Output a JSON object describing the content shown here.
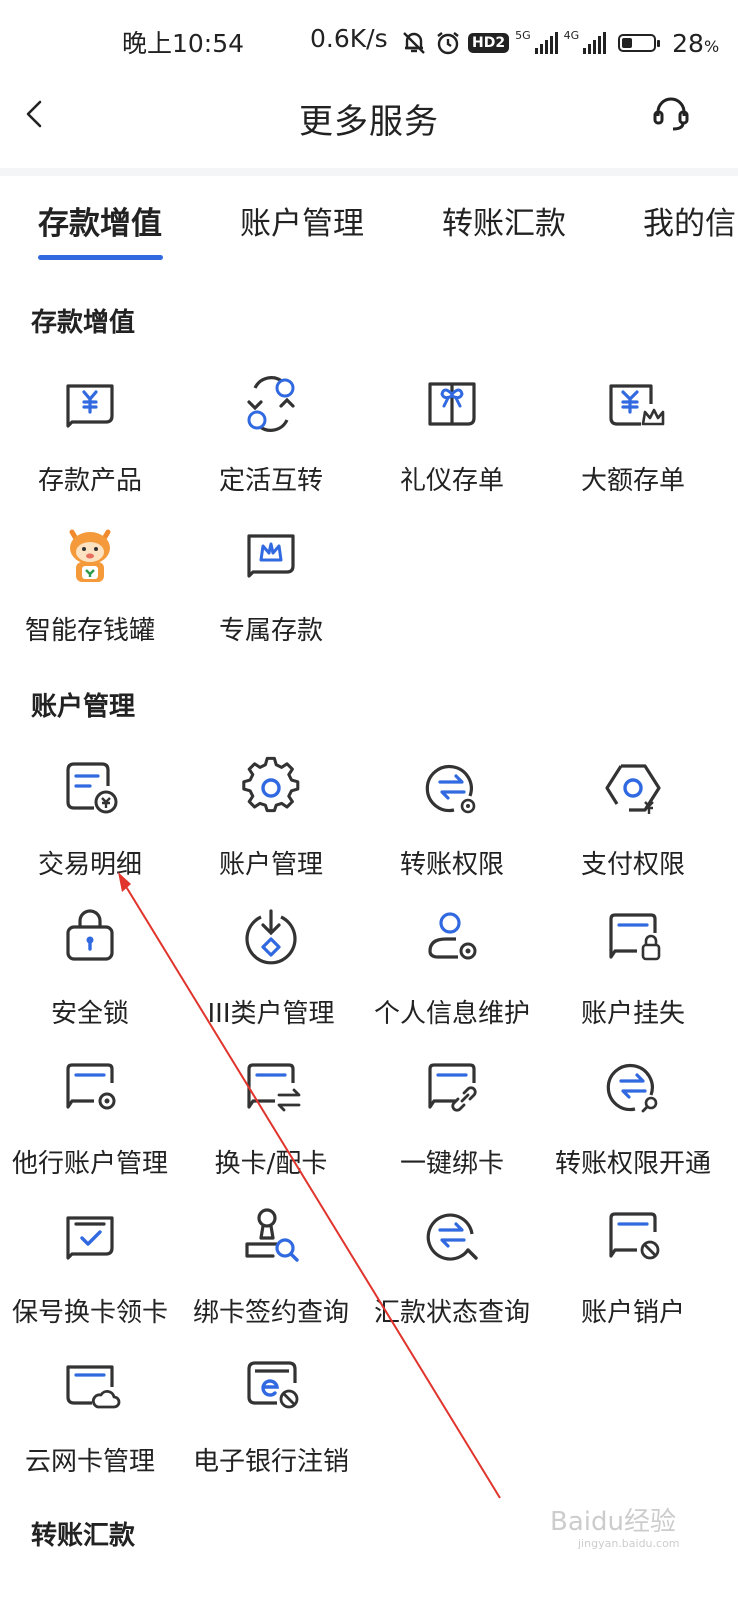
{
  "status_bar": {
    "time": "晚上10:54",
    "speed": "0.6K/s",
    "hd_badge": "HD2",
    "net_5g": "5G",
    "net_4g": "4G",
    "battery": "28",
    "battery_unit": "%",
    "battery_level": 0.28
  },
  "header": {
    "title": "更多服务"
  },
  "tabs": [
    {
      "label": "存款增值",
      "active": true
    },
    {
      "label": "账户管理",
      "active": false
    },
    {
      "label": "转账汇款",
      "active": false
    },
    {
      "label": "我的信",
      "active": false
    }
  ],
  "sections": [
    {
      "title": "存款增值",
      "items": [
        {
          "label": "存款产品",
          "icon": "deposit-product-icon"
        },
        {
          "label": "定活互转",
          "icon": "fixed-demand-transfer-icon"
        },
        {
          "label": "礼仪存单",
          "icon": "gift-certificate-icon"
        },
        {
          "label": "大额存单",
          "icon": "large-deposit-icon"
        },
        {
          "label": "智能存钱罐",
          "icon": "piggy-bank-mascot-icon"
        },
        {
          "label": "专属存款",
          "icon": "exclusive-deposit-icon"
        }
      ]
    },
    {
      "title": "账户管理",
      "items": [
        {
          "label": "交易明细",
          "icon": "transaction-details-icon"
        },
        {
          "label": "账户管理",
          "icon": "account-settings-icon"
        },
        {
          "label": "转账权限",
          "icon": "transfer-permission-icon"
        },
        {
          "label": "支付权限",
          "icon": "payment-permission-icon"
        },
        {
          "label": "安全锁",
          "icon": "lock-icon"
        },
        {
          "label": "III类户管理",
          "icon": "class3-account-icon"
        },
        {
          "label": "个人信息维护",
          "icon": "user-settings-icon"
        },
        {
          "label": "账户挂失",
          "icon": "card-lock-icon"
        },
        {
          "label": "他行账户管理",
          "icon": "card-gear-icon"
        },
        {
          "label": "换卡/配卡",
          "icon": "card-exchange-icon"
        },
        {
          "label": "一键绑卡",
          "icon": "card-link-icon"
        },
        {
          "label": "转账权限开通",
          "icon": "transfer-search-icon"
        },
        {
          "label": "保号换卡领卡",
          "icon": "card-check-icon"
        },
        {
          "label": "绑卡签约查询",
          "icon": "stamp-search-icon"
        },
        {
          "label": "汇款状态查询",
          "icon": "remittance-query-icon"
        },
        {
          "label": "账户销户",
          "icon": "card-cancel-icon"
        },
        {
          "label": "云网卡管理",
          "icon": "cloud-card-icon"
        },
        {
          "label": "电子银行注销",
          "icon": "ebank-cancel-icon"
        }
      ]
    },
    {
      "title": "转账汇款",
      "items": []
    }
  ],
  "watermark": {
    "text": "Baidu经验",
    "sub": "jingyan.baidu.com"
  },
  "colors": {
    "accent": "#3169e0",
    "icon_stroke": "#333333",
    "annotation": "#e0342c",
    "mascot": "#f08a2c"
  }
}
